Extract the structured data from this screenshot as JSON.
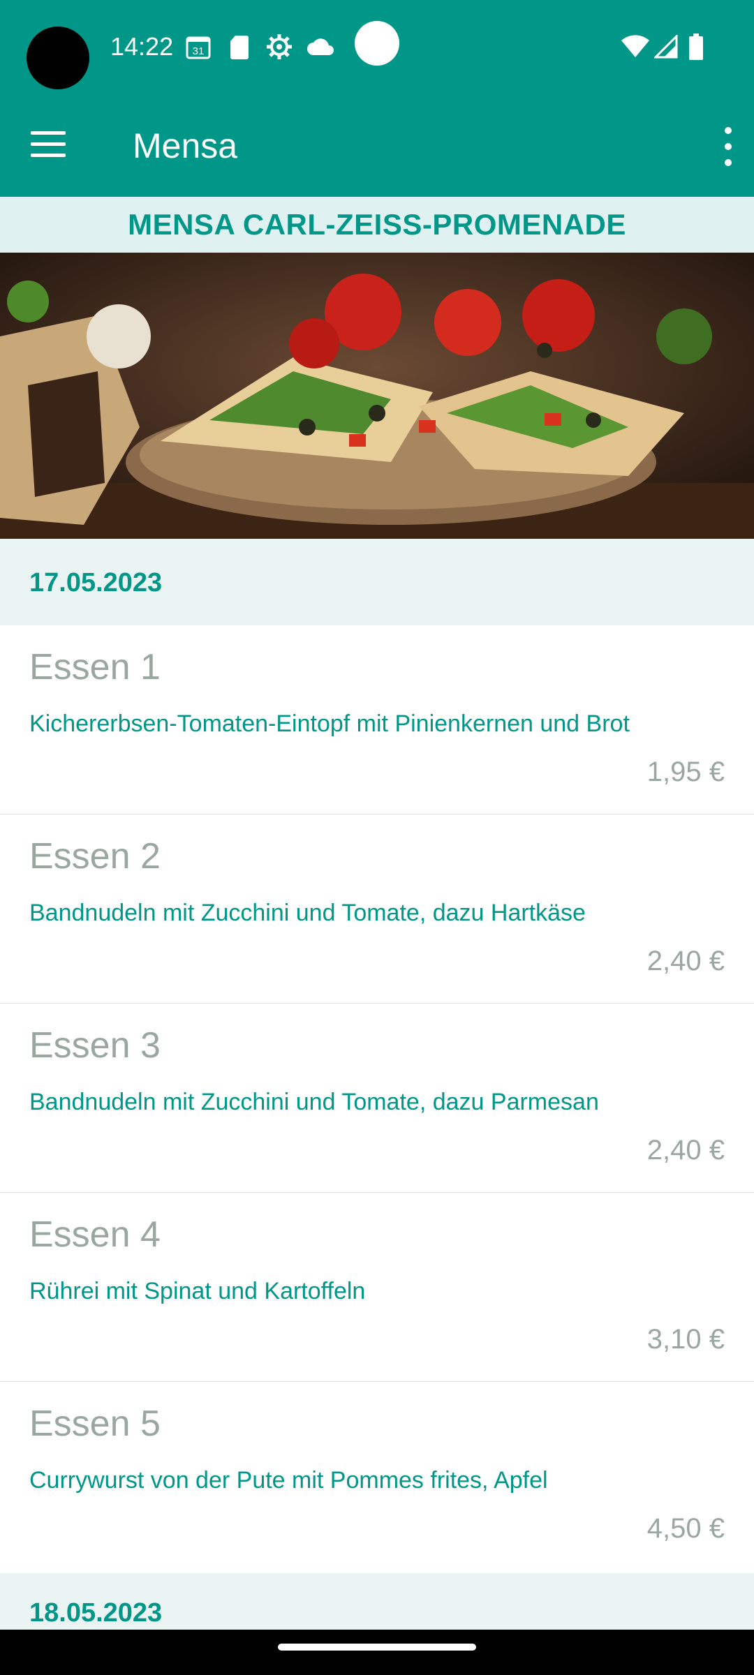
{
  "status_bar": {
    "time": "14:22",
    "calendar_day": "31",
    "icons": [
      "calendar-icon",
      "sd-card-icon",
      "settings-gear-icon",
      "cloud-icon",
      "wifi-icon",
      "signal-icon",
      "battery-icon"
    ]
  },
  "app_bar": {
    "title": "Mensa",
    "menu_icon": "hamburger-menu-icon",
    "overflow_icon": "more-vert-icon"
  },
  "canteen": {
    "name": "MENSA CARL-ZEISS-PROMENADE"
  },
  "hero_image": {
    "subject": "pizza with tomatoes, arugula and olives"
  },
  "days": [
    {
      "date": "17.05.2023",
      "meals": [
        {
          "name": "Essen 1",
          "description": "Kichererbsen-Tomaten-Eintopf mit Pinienkernen und Brot",
          "price": "1,95 €"
        },
        {
          "name": "Essen 2",
          "description": "Bandnudeln mit Zucchini und Tomate, dazu Hartkäse",
          "price": "2,40 €"
        },
        {
          "name": "Essen 3",
          "description": "Bandnudeln mit Zucchini und Tomate, dazu Parmesan",
          "price": "2,40 €"
        },
        {
          "name": "Essen 4",
          "description": "Rührei mit Spinat und Kartoffeln",
          "price": "3,10 €"
        },
        {
          "name": "Essen 5",
          "description": "Currywurst von der Pute mit Pommes frites, Apfel",
          "price": "4,50 €"
        }
      ]
    },
    {
      "date": "18.05.2023"
    }
  ],
  "colors": {
    "primary": "#009688",
    "header_bg": "#dff1f1",
    "muted_text": "#9aa7a1"
  }
}
